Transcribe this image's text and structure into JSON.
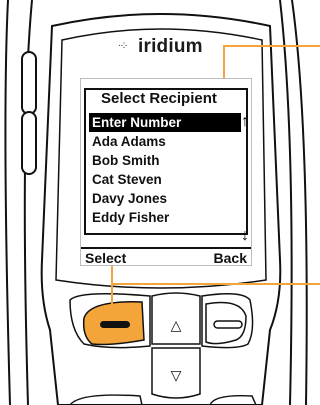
{
  "brand": {
    "dots": "··:·",
    "name": "iridium"
  },
  "screen": {
    "title": "Select Recipient",
    "items": [
      {
        "label": "Enter Number",
        "selected": true
      },
      {
        "label": "Ada Adams",
        "selected": false
      },
      {
        "label": "Bob Smith",
        "selected": false
      },
      {
        "label": "Cat Steven",
        "selected": false
      },
      {
        "label": "Davy Jones",
        "selected": false
      },
      {
        "label": "Eddy Fisher",
        "selected": false
      }
    ],
    "scroll_up_glyph": "↑",
    "scroll_down_glyph": "↓",
    "softkey_left": "Select",
    "softkey_right": "Back"
  },
  "keys": {
    "up_glyph": "△",
    "down_glyph": "▽"
  },
  "colors": {
    "highlight_key": "#f4a53a",
    "screen_selection": "#000000",
    "callout_line": "#f4a53a"
  }
}
